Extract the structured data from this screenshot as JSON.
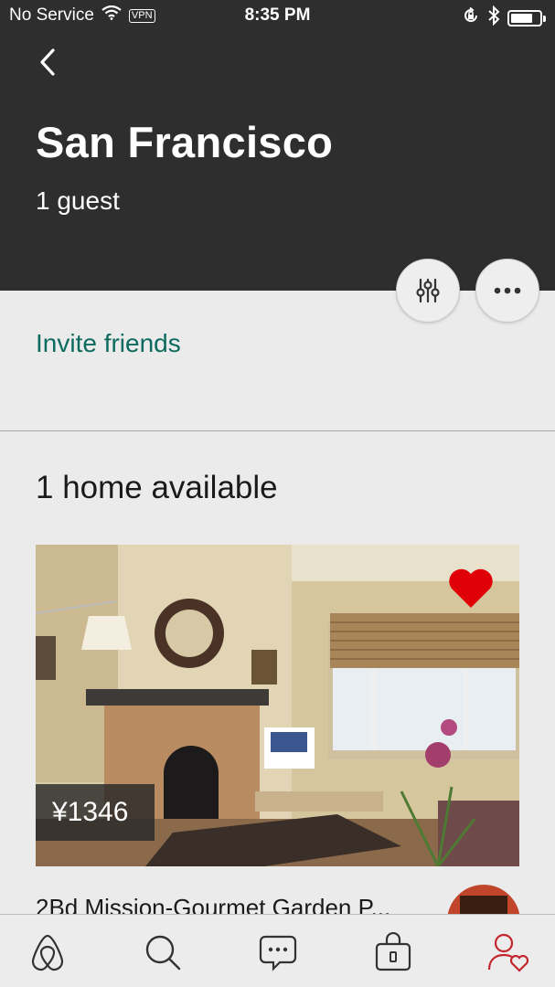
{
  "status_bar": {
    "carrier": "No Service",
    "vpn": "VPN",
    "time": "8:35 PM",
    "battery_level": 0.75
  },
  "header": {
    "back_icon": "chevron-left-icon",
    "title": "San Francisco",
    "guests": "1 guest",
    "filter_icon": "sliders-icon",
    "more_icon": "ellipsis-icon"
  },
  "invite": {
    "label": "Invite friends"
  },
  "results": {
    "count_label": "1 home available"
  },
  "listing": {
    "price": "¥1346",
    "title": "2Bd Mission-Gourmet Garden P...",
    "saved": true,
    "heart_color": "#e00007"
  },
  "tab_bar": {
    "tabs": [
      {
        "icon": "airbnb-logo-icon",
        "active": false
      },
      {
        "icon": "search-icon",
        "active": false
      },
      {
        "icon": "messages-icon",
        "active": false
      },
      {
        "icon": "trips-bag-icon",
        "active": false
      },
      {
        "icon": "profile-heart-icon",
        "active": true
      }
    ]
  },
  "colors": {
    "header_bg": "#2e2e2e",
    "accent_link": "#0c6b5e",
    "active_tab": "#c4262e",
    "inactive_tab": "#333333"
  }
}
